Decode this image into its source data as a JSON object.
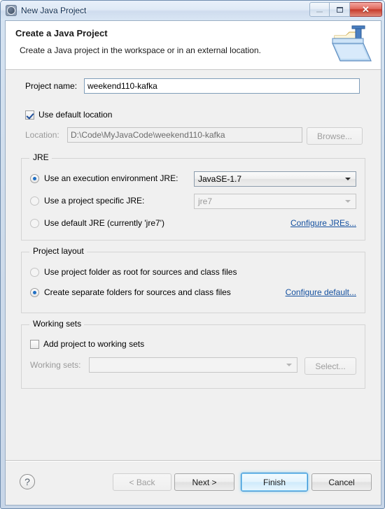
{
  "window": {
    "title": "New Java Project",
    "icon": "wizard-gear-icon",
    "buttons": {
      "minimize": "minimize-icon",
      "maximize": "maximize-icon",
      "close": "✕"
    }
  },
  "header": {
    "title": "Create a Java Project",
    "description": "Create a Java project in the workspace or in an external location.",
    "banner_icon": "java-project-folder-icon"
  },
  "form": {
    "project_name_label": "Project name:",
    "project_name_value": "weekend110-kafka",
    "use_default_location_label": "Use default location",
    "use_default_location_checked": true,
    "location_label": "Location:",
    "location_value": "D:\\Code\\MyJavaCode\\weekend110-kafka",
    "browse_label": "Browse..."
  },
  "jre": {
    "group_title": "JRE",
    "options": [
      {
        "label": "Use an execution environment JRE:",
        "selected": true,
        "combo_value": "JavaSE-1.7",
        "combo_enabled": true
      },
      {
        "label": "Use a project specific JRE:",
        "selected": false,
        "combo_value": "jre7",
        "combo_enabled": false
      },
      {
        "label": "Use default JRE (currently 'jre7')",
        "selected": false
      }
    ],
    "configure_link": "Configure JREs..."
  },
  "project_layout": {
    "group_title": "Project layout",
    "options": [
      {
        "label": "Use project folder as root for sources and class files",
        "selected": false
      },
      {
        "label": "Create separate folders for sources and class files",
        "selected": true
      }
    ],
    "configure_link": "Configure default..."
  },
  "working_sets": {
    "group_title": "Working sets",
    "add_label": "Add project to working sets",
    "add_checked": false,
    "sets_label": "Working sets:",
    "sets_value": "",
    "select_label": "Select..."
  },
  "footer": {
    "help_icon": "?",
    "back_label": "< Back",
    "back_enabled": false,
    "next_label": "Next >",
    "next_enabled": true,
    "finish_label": "Finish",
    "finish_default": true,
    "cancel_label": "Cancel"
  },
  "colors": {
    "dialog_bg": "#f0f0f0",
    "header_bg": "#ffffff",
    "link": "#14509f",
    "accent_selected": "#1f6fc4",
    "close_button": "#c73b2c"
  }
}
